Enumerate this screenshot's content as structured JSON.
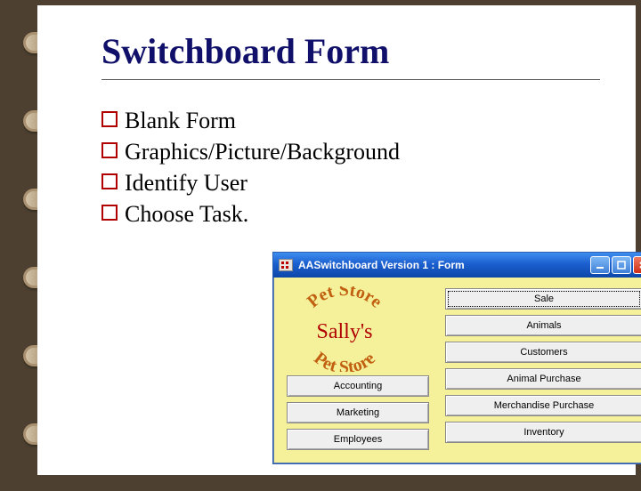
{
  "slide": {
    "title": "Switchboard Form",
    "bullets": [
      "Blank Form",
      "Graphics/Picture/Background",
      "Identify User",
      "Choose Task."
    ]
  },
  "window": {
    "title": "AASwitchboard Version 1 : Form",
    "logo_text": "Sally's Pet Store",
    "right_buttons": [
      "Sale",
      "Animals",
      "Customers",
      "Animal Purchase",
      "Merchandise Purchase",
      "Inventory"
    ],
    "left_buttons": [
      "Accounting",
      "Marketing",
      "Employees"
    ]
  }
}
